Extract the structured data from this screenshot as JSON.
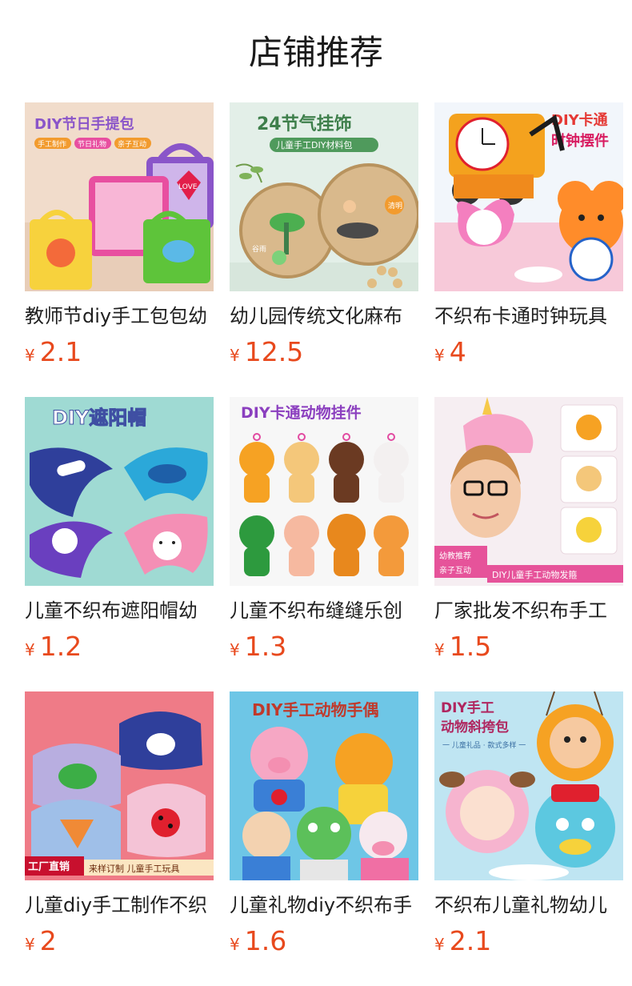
{
  "header": {
    "title": "店铺推荐"
  },
  "products": [
    {
      "name": "教师节diy手工包包幼",
      "currency": "¥",
      "price": "2.1",
      "image": {
        "headline": "DIY节日手提包",
        "tags": [
          "手工制作",
          "节日礼物",
          "亲子互动"
        ],
        "sticker": "LOVE",
        "bg": "#f1dccb",
        "accent": "#8a55c9"
      }
    },
    {
      "name": "幼儿园传统文化麻布",
      "currency": "¥",
      "price": "12.5",
      "image": {
        "headline": "24节气挂饰",
        "subhead": "儿童手工DIY材料包",
        "tags": [
          "谷雨",
          "清明"
        ],
        "bg": "#e3efe8",
        "accent": "#3e7f4b"
      }
    },
    {
      "name": "不织布卡通时钟玩具",
      "currency": "¥",
      "price": "4",
      "image": {
        "headline": "DIY卡通",
        "subhead": "时钟摆件",
        "bg": "#f2f6fb",
        "accent": "#e53935"
      }
    },
    {
      "name": "儿童不织布遮阳帽幼",
      "currency": "¥",
      "price": "1.2",
      "image": {
        "headline": "DIY遮阳帽",
        "bg": "#9fdad3",
        "accent": "#3f4fa3"
      }
    },
    {
      "name": "儿童不织布缝缝乐创",
      "currency": "¥",
      "price": "1.3",
      "image": {
        "headline": "DIY卡通动物挂件",
        "bg": "#f7f7f7",
        "accent": "#8b3fbf"
      }
    },
    {
      "name": "厂家批发不织布手工",
      "currency": "¥",
      "price": "1.5",
      "image": {
        "tags": [
          "幼教推荐",
          "亲子互动"
        ],
        "subhead": "DIY儿童手工动物发箍",
        "bg": "#f6eef2",
        "accent": "#d44c8a"
      }
    },
    {
      "name": "儿童diy手工制作不织",
      "currency": "¥",
      "price": "2",
      "image": {
        "tags": [
          "工厂直销"
        ],
        "subhead": "来样订制 儿童手工玩具",
        "bg": "#ef7b87",
        "accent": "#c8102e"
      }
    },
    {
      "name": "儿童礼物diy不织布手",
      "currency": "¥",
      "price": "1.6",
      "image": {
        "headline": "DIY手工动物手偶",
        "bg": "#6ec6e6",
        "accent": "#c0392b"
      }
    },
    {
      "name": "不织布儿童礼物幼儿",
      "currency": "¥",
      "price": "2.1",
      "image": {
        "headline": "DIY手工",
        "subhead": "动物斜挎包",
        "tags": [
          "一 儿童礼品 · 款式多样 一"
        ],
        "bg": "#bfe5f2",
        "accent": "#b0265f"
      }
    }
  ]
}
